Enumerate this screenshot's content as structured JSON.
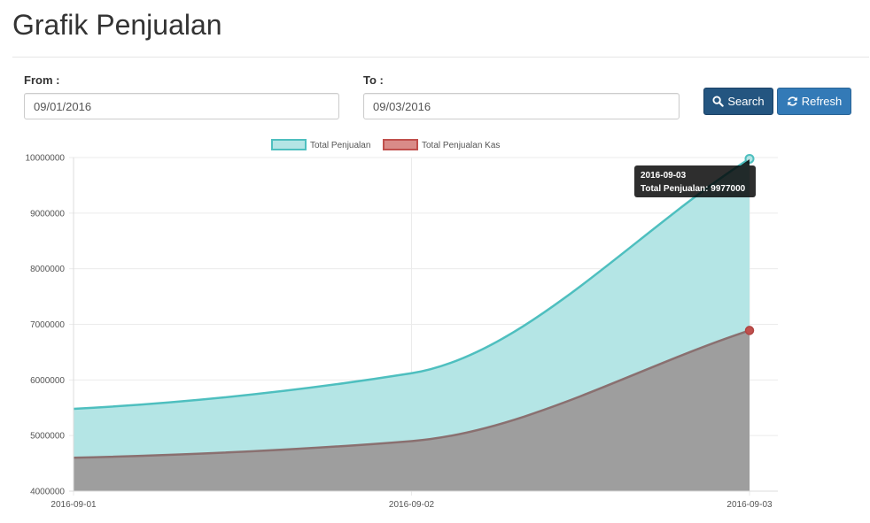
{
  "page": {
    "title": "Grafik Penjualan"
  },
  "filters": {
    "from_label": "From :",
    "from_value": "09/01/2016",
    "to_label": "To :",
    "to_value": "09/03/2016"
  },
  "buttons": {
    "search_label": "Search",
    "refresh_label": "Refresh"
  },
  "icons": {
    "search": "search-icon",
    "refresh": "refresh-icon"
  },
  "colors": {
    "primary_dark": "#245580",
    "primary": "#337ab7",
    "series_total": "#4ebfbf",
    "series_total_fill": "#b4e5e5",
    "series_kas": "#c0504d",
    "series_kas_fill": "#9e9e9e"
  },
  "chart_data": {
    "type": "area",
    "title": "",
    "xlabel": "",
    "ylabel": "",
    "categories": [
      "2016-09-01",
      "2016-09-02",
      "2016-09-03"
    ],
    "series": [
      {
        "name": "Total Penjualan",
        "values": [
          5480000,
          6120000,
          9977000
        ]
      },
      {
        "name": "Total Penjualan Kas",
        "values": [
          4600000,
          4900000,
          6890000
        ]
      }
    ],
    "ylim": [
      4000000,
      10000000
    ],
    "yticks": [
      4000000,
      5000000,
      6000000,
      7000000,
      8000000,
      9000000,
      10000000
    ],
    "grid": true,
    "legend": "top",
    "tooltip": {
      "title": "2016-09-03",
      "line": "Total Penjualan: 9977000"
    }
  }
}
